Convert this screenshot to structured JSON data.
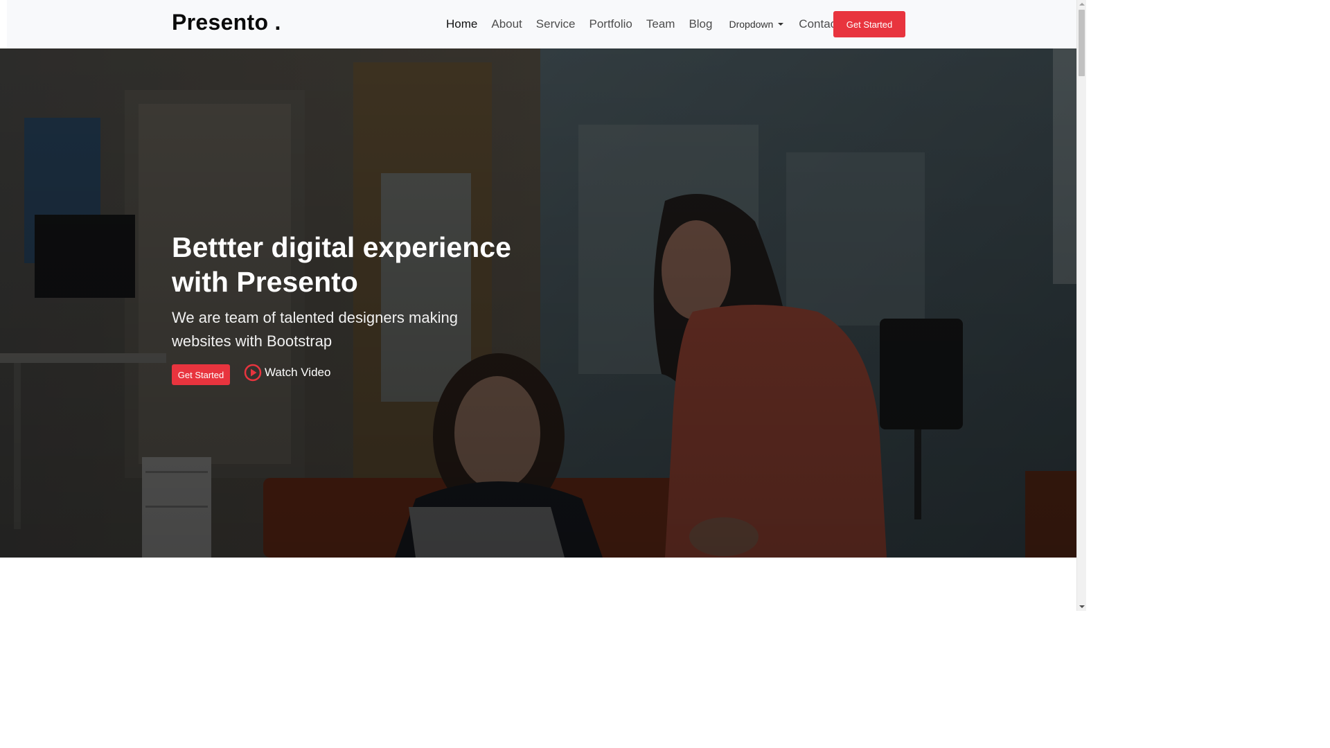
{
  "header": {
    "brand": "Presento .",
    "nav": [
      {
        "label": "Home",
        "active": true
      },
      {
        "label": "About",
        "active": false
      },
      {
        "label": "Service",
        "active": false
      },
      {
        "label": "Portfolio",
        "active": false
      },
      {
        "label": "Team",
        "active": false
      },
      {
        "label": "Blog",
        "active": false
      }
    ],
    "dropdown_label": "Dropdown",
    "contact_label": "Contact",
    "cta_label": "Get Started"
  },
  "hero": {
    "title_line1": "Bettter digital experience",
    "title_line2": "with Presento",
    "subtitle": "We are team of talented designers making websites with Bootstrap",
    "cta_label": "Get Started",
    "video_label": "Watch Video",
    "video_icon": "play-circle-icon"
  },
  "colors": {
    "accent": "#e8343e",
    "nav_bg": "#f8f9fb",
    "hero_overlay": "#000000"
  }
}
